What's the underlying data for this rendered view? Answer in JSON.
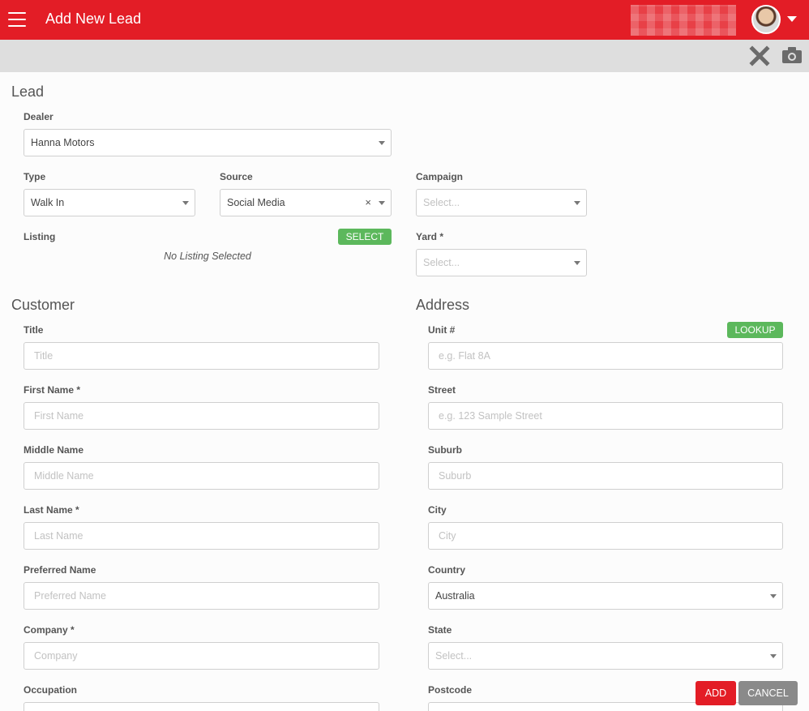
{
  "header": {
    "title": "Add New Lead"
  },
  "lead": {
    "section_title": "Lead",
    "dealer": {
      "label": "Dealer",
      "value": "Hanna Motors"
    },
    "type": {
      "label": "Type",
      "value": "Walk In"
    },
    "source": {
      "label": "Source",
      "value": "Social Media",
      "clear": "×"
    },
    "campaign": {
      "label": "Campaign",
      "placeholder": "Select..."
    },
    "listing": {
      "label": "Listing",
      "select_label": "SELECT",
      "empty_text": "No Listing Selected"
    },
    "yard": {
      "label": "Yard *",
      "placeholder": "Select..."
    }
  },
  "customer": {
    "section_title": "Customer",
    "title": {
      "label": "Title",
      "placeholder": "Title"
    },
    "first_name": {
      "label": "First Name *",
      "placeholder": "First Name"
    },
    "middle_name": {
      "label": "Middle Name",
      "placeholder": "Middle Name"
    },
    "last_name": {
      "label": "Last Name *",
      "placeholder": "Last Name"
    },
    "preferred_name": {
      "label": "Preferred Name",
      "placeholder": "Preferred Name"
    },
    "company": {
      "label": "Company *",
      "placeholder": "Company"
    },
    "occupation": {
      "label": "Occupation"
    }
  },
  "address": {
    "section_title": "Address",
    "lookup_label": "LOOKUP",
    "unit": {
      "label": "Unit #",
      "placeholder": "e.g. Flat 8A"
    },
    "street": {
      "label": "Street",
      "placeholder": "e.g. 123 Sample Street"
    },
    "suburb": {
      "label": "Suburb",
      "placeholder": "Suburb"
    },
    "city": {
      "label": "City",
      "placeholder": "City"
    },
    "country": {
      "label": "Country",
      "value": "Australia"
    },
    "state": {
      "label": "State",
      "placeholder": "Select..."
    },
    "postcode": {
      "label": "Postcode"
    }
  },
  "actions": {
    "add_label": "ADD",
    "cancel_label": "CANCEL"
  },
  "colors": {
    "brand": "#e31d26",
    "success": "#5cb85c",
    "neutral": "#8a8a8a"
  },
  "icons": [
    "hamburger-icon",
    "close-icon",
    "camera-icon",
    "chevron-down-icon"
  ]
}
